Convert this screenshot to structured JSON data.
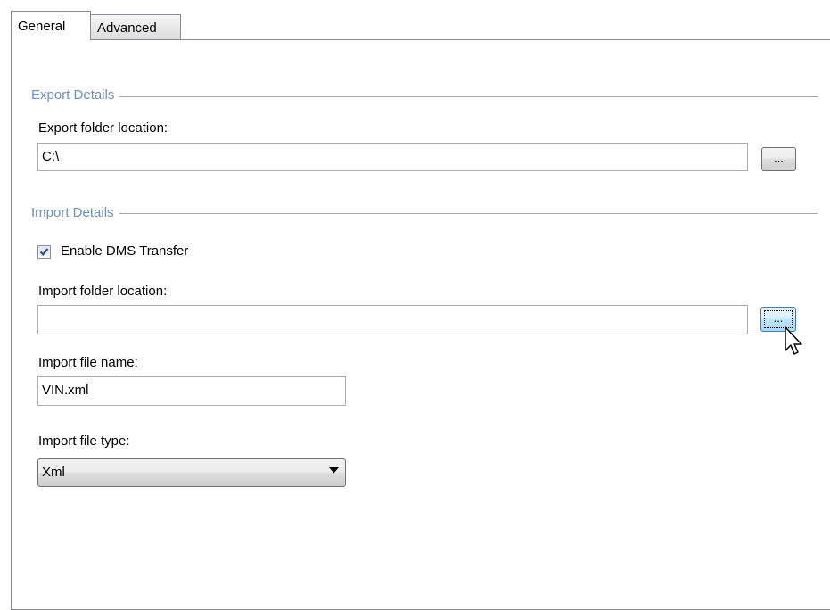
{
  "tabs": [
    {
      "label": "General",
      "active": true
    },
    {
      "label": "Advanced",
      "active": false
    }
  ],
  "export_group": {
    "title": "Export Details",
    "folder_label": "Export folder location:",
    "folder_value": "C:\\",
    "browse_label": "..."
  },
  "import_group": {
    "title": "Import Details",
    "enable_label": "Enable DMS Transfer",
    "enable_checked": true,
    "folder_label": "Import folder location:",
    "folder_value": "",
    "browse_label": "...",
    "file_name_label": "Import file name:",
    "file_name_value": "VIN.xml",
    "file_type_label": "Import file type:",
    "file_type_value": "Xml"
  },
  "colors": {
    "group_title": "#6b90c4",
    "hover_button": "#bee6fd",
    "check_mark": "#2a4f8f"
  },
  "icons": {
    "checkbox_mark": "check-icon",
    "dropdown": "dropdown-arrow-icon",
    "pointer": "mouse-pointer-icon"
  }
}
